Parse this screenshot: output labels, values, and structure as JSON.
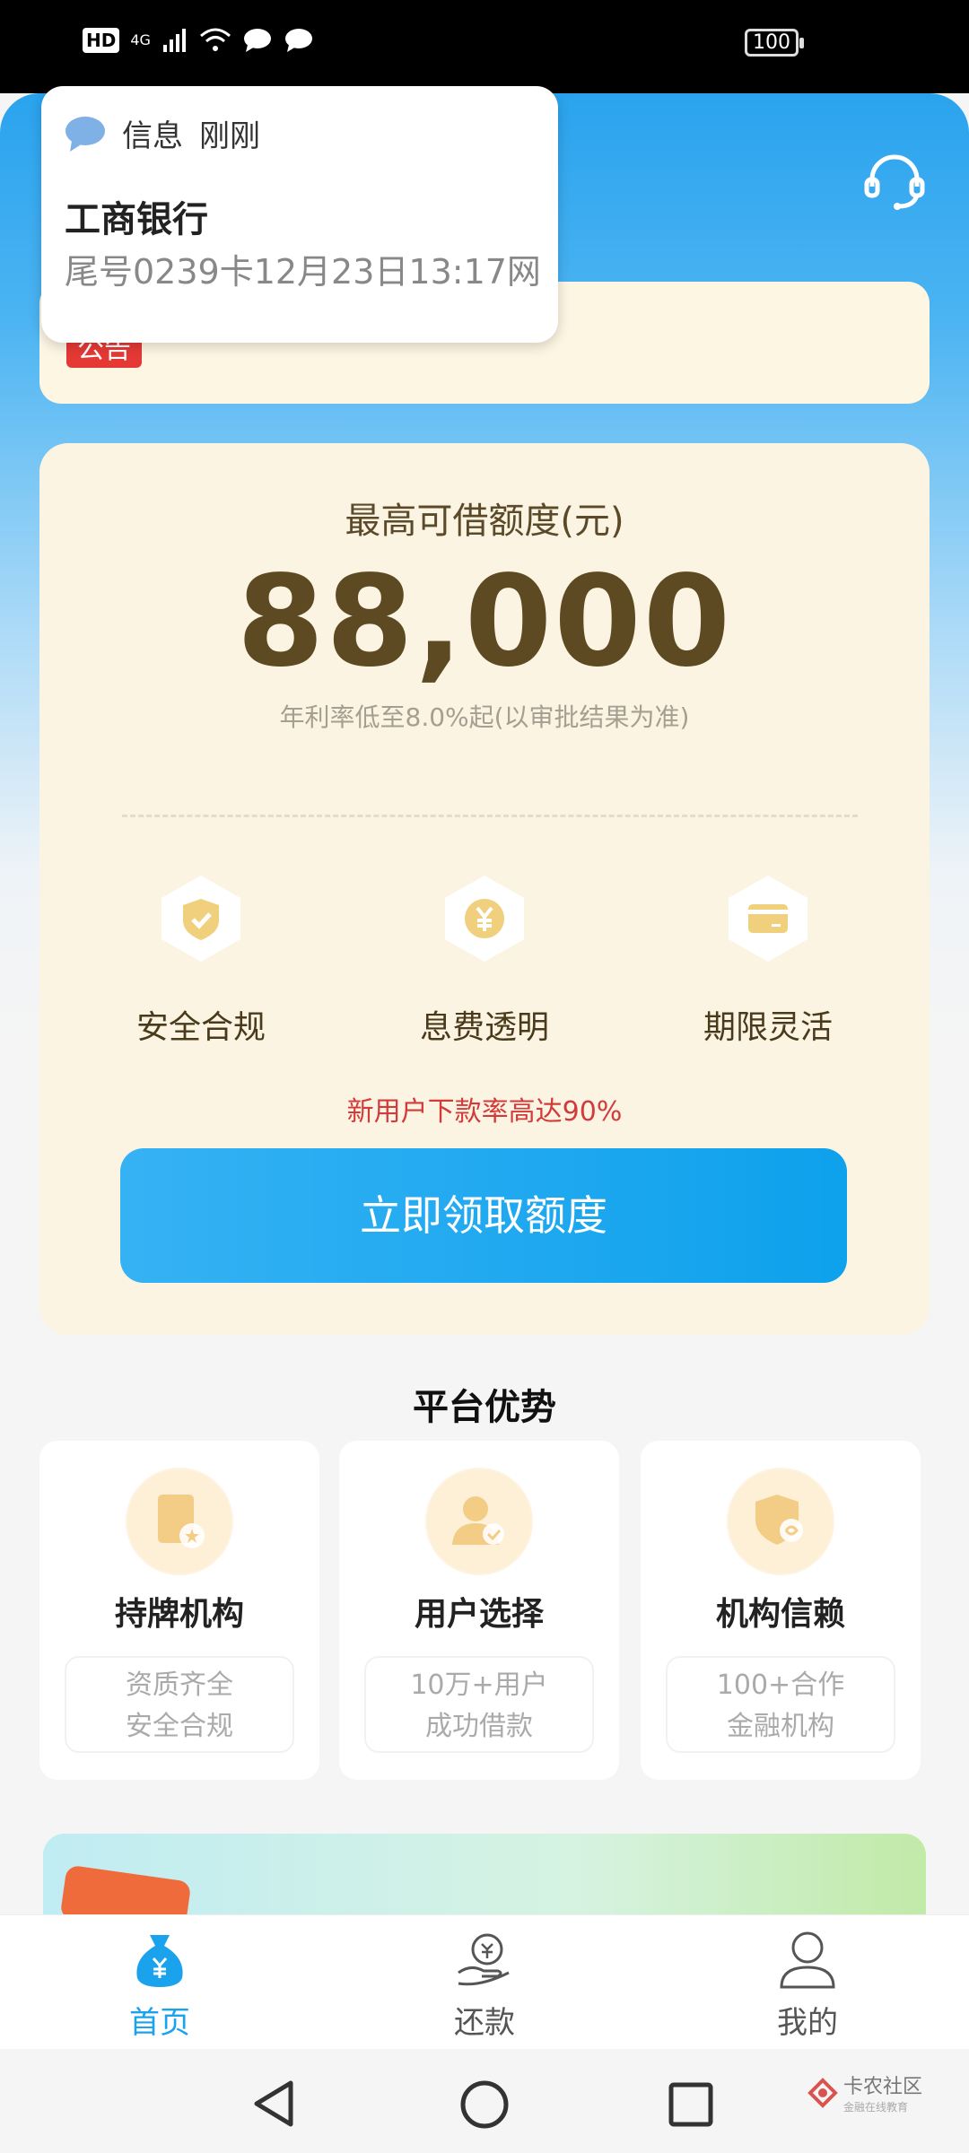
{
  "status_bar": {
    "hd": "HD",
    "network": "4G",
    "battery": "100"
  },
  "notification": {
    "app": "信息",
    "time": "刚刚",
    "title": "工商银行",
    "body": "尾号0239卡12月23日13:17网"
  },
  "notice": {
    "tag": "公告"
  },
  "quota": {
    "label": "最高可借额度(元)",
    "amount": "88,000",
    "rate_note": "年利率低至8.0%起(以审批结果为准)",
    "features": [
      "安全合规",
      "息费透明",
      "期限灵活"
    ],
    "promo": "新用户下款率高达90%",
    "button": "立即领取额度"
  },
  "advantages": {
    "title": "平台优势",
    "items": [
      {
        "title": "持牌机构",
        "desc1": "资质齐全",
        "desc2": "安全合规"
      },
      {
        "title": "用户选择",
        "desc1": "10万+用户",
        "desc2": "成功借款"
      },
      {
        "title": "机构信赖",
        "desc1": "100+合作",
        "desc2": "金融机构"
      }
    ]
  },
  "nav": {
    "home": "首页",
    "repay": "还款",
    "mine": "我的"
  },
  "watermark": {
    "line1": "卡农社区",
    "line2": "金融在线教育"
  },
  "colors": {
    "accent": "#1aa3ec",
    "amount": "#5d4a22",
    "promo": "#d23b3b"
  }
}
